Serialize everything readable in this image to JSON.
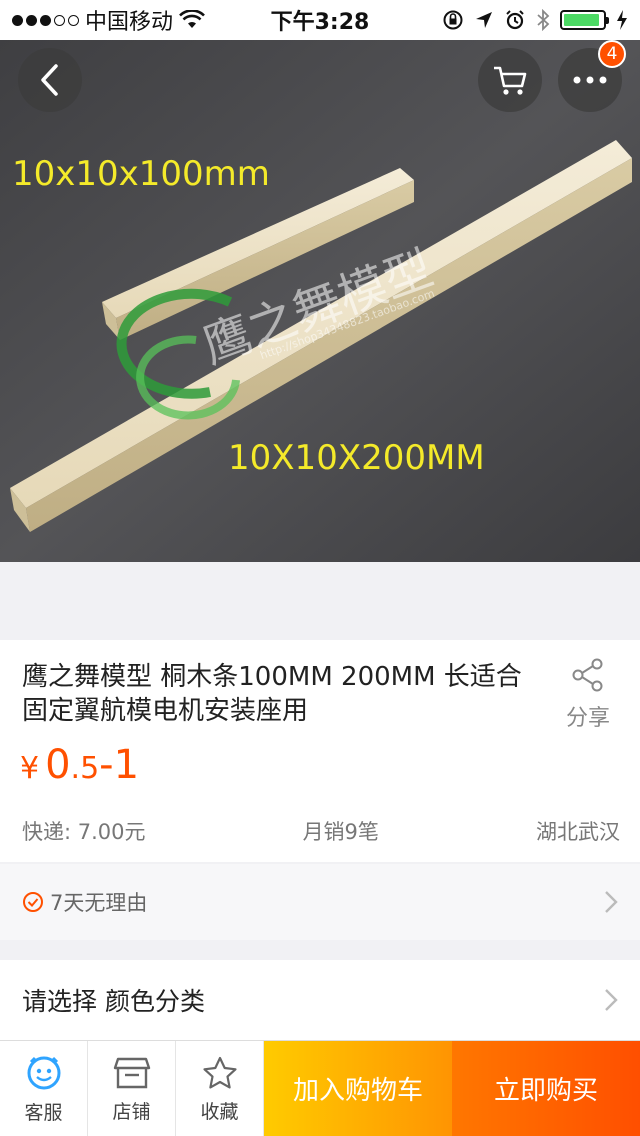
{
  "status_bar": {
    "carrier": "中国移动",
    "time": "下午3:28"
  },
  "nav": {
    "back_icon": "back-arrow-icon",
    "cart_icon": "cart-icon",
    "more_icon": "more-icon",
    "more_badge": "4"
  },
  "hero": {
    "label_small": "10x10x100mm",
    "label_large": "10X10X200MM",
    "watermark": "鹰之舞模型",
    "watermark_url": "http://shop34348823.taobao.com"
  },
  "product": {
    "title": "鹰之舞模型  桐木条100MM 200MM 长适合固定翼航模电机安装座用",
    "share_label": "分享",
    "price_symbol": "¥",
    "price_main": "0",
    "price_decimal": ".5",
    "price_range_end": "-1",
    "shipping": "快递: 7.00元",
    "monthly_sales": "月销9笔",
    "location": "湖北武汉"
  },
  "service": {
    "label": "7天无理由"
  },
  "select": {
    "label": "请选择 颜色分类"
  },
  "bottom_bar": {
    "service_label": "客服",
    "shop_label": "店铺",
    "favorite_label": "收藏",
    "add_to_cart_label": "加入购物车",
    "buy_now_label": "立即购买"
  },
  "colors": {
    "accent": "#ff5000",
    "cart_button": "#ff9402",
    "buy_button": "#ff5000",
    "label_yellow": "#f4ea2a"
  }
}
